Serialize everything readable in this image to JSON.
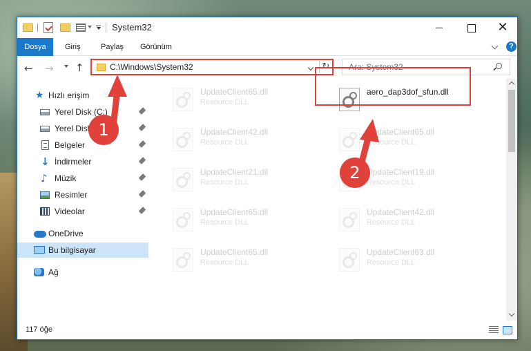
{
  "window": {
    "title": "System32"
  },
  "ribbon": {
    "tabs": [
      {
        "label": "Dosya",
        "active": true
      },
      {
        "label": "Giriş"
      },
      {
        "label": "Paylaş"
      },
      {
        "label": "Görünüm"
      }
    ],
    "help_label": "?"
  },
  "navbar": {
    "back_icon": "←",
    "forward_icon": "→",
    "up_icon": "↑",
    "refresh_icon": "↻",
    "address": "C:\\Windows\\System32",
    "search_placeholder": "Ara: System32"
  },
  "sidebar": {
    "items": [
      {
        "label": "Hızlı erişim",
        "icon": "star-icon"
      },
      {
        "label": "Yerel Disk (C:)",
        "icon": "disk-icon",
        "pinned": true
      },
      {
        "label": "Yerel Disk (D:)",
        "icon": "disk-icon",
        "pinned": true
      },
      {
        "label": "Belgeler",
        "icon": "document-icon",
        "pinned": true
      },
      {
        "label": "İndirmeler",
        "icon": "download-icon",
        "pinned": true
      },
      {
        "label": "Müzik",
        "icon": "music-icon",
        "pinned": true
      },
      {
        "label": "Resimler",
        "icon": "picture-icon",
        "pinned": true
      },
      {
        "label": "Videolar",
        "icon": "video-icon",
        "pinned": true
      },
      {
        "label": "OneDrive",
        "icon": "cloud-icon"
      },
      {
        "label": "Bu bilgisayar",
        "icon": "computer-icon",
        "selected": true
      },
      {
        "label": "Ağ",
        "icon": "network-icon"
      }
    ]
  },
  "files": [
    {
      "name": "UpdateClient65.dll",
      "type": "Resource DLL",
      "faded": true
    },
    {
      "name": "aero_dap3dof_sfun.dll",
      "type": "",
      "highlighted": true
    },
    {
      "name": "UpdateClient42.dll",
      "type": "Resource DLL",
      "faded": true
    },
    {
      "name": "UpdateClient65.dll",
      "type": "Resource DLL",
      "faded": true
    },
    {
      "name": "UpdateClient21.dll",
      "type": "Resource DLL",
      "faded": true
    },
    {
      "name": "UpdateClient19.dll",
      "type": "Resource DLL",
      "faded": true
    },
    {
      "name": "UpdateClient65.dll",
      "type": "Resource DLL",
      "faded": true
    },
    {
      "name": "UpdateClient42.dll",
      "type": "Resource DLL",
      "faded": true
    },
    {
      "name": "UpdateClient65.dll",
      "type": "Resource DLL",
      "faded": true
    },
    {
      "name": "UpdateClient63.dll",
      "type": "Resource DLL",
      "faded": true
    }
  ],
  "status": {
    "item_count": "117 öğe"
  },
  "annotations": {
    "step1": "1",
    "step2": "2",
    "color": "#e0413b"
  },
  "colors": {
    "accent": "#1979ca",
    "selection": "#cce4f7"
  }
}
